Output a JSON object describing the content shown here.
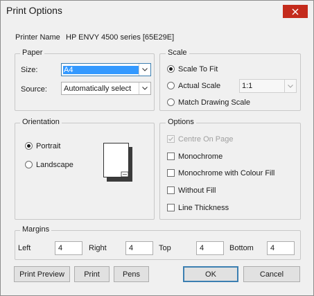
{
  "window": {
    "title": "Print Options"
  },
  "printer": {
    "label": "Printer Name",
    "value": "HP ENVY 4500 series [65E29E]"
  },
  "paper": {
    "legend": "Paper",
    "size_label": "Size:",
    "size_value": "A4",
    "source_label": "Source:",
    "source_value": "Automatically select"
  },
  "scale": {
    "legend": "Scale",
    "fit_label": "Scale To Fit",
    "actual_label": "Actual Scale",
    "actual_value": "1:1",
    "match_label": "Match Drawing Scale",
    "selected": "fit"
  },
  "orientation": {
    "legend": "Orientation",
    "portrait_label": "Portrait",
    "landscape_label": "Landscape",
    "selected": "portrait"
  },
  "options": {
    "legend": "Options",
    "centre_label": "Centre On Page",
    "mono_label": "Monochrome",
    "mono_fill_label": "Monochrome with Colour Fill",
    "no_fill_label": "Without Fill",
    "line_label": "Line Thickness"
  },
  "margins": {
    "legend": "Margins",
    "left_label": "Left",
    "left_value": "4",
    "right_label": "Right",
    "right_value": "4",
    "top_label": "Top",
    "top_value": "4",
    "bottom_label": "Bottom",
    "bottom_value": "4"
  },
  "buttons": {
    "preview": "Print Preview",
    "print": "Print",
    "pens": "Pens",
    "ok": "OK",
    "cancel": "Cancel"
  },
  "colors": {
    "close_bg": "#c42b1c",
    "focus_border": "#3c7fb1"
  }
}
